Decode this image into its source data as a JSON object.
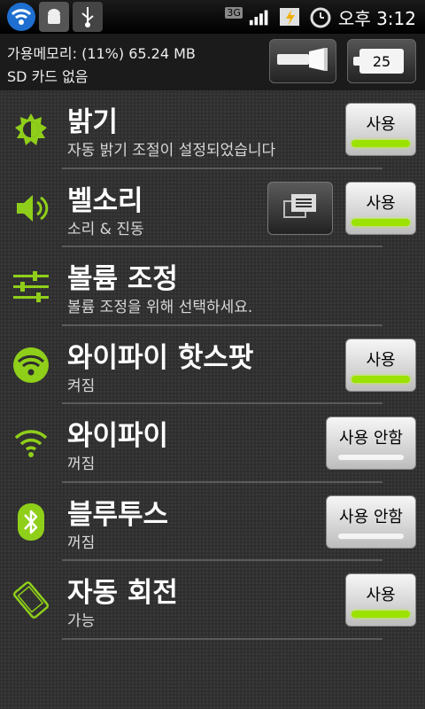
{
  "status_bar": {
    "network_tag": "3G",
    "time": "오후 3:12",
    "icons": [
      "wifi-hotspot-icon",
      "android-debug-icon",
      "usb-icon",
      "signal-icon",
      "battery-charging-icon",
      "alarm-icon"
    ]
  },
  "header": {
    "memory_line": "가용메모리: (11%) 65.24 MB",
    "sd_line": "SD 카드 없음",
    "flashlight_icon": "flashlight-icon",
    "battery_level": "25"
  },
  "settings": [
    {
      "title": "밝기",
      "subtitle": "자동 밝기 조절이 설정되었습니다",
      "toggle_label": "사용",
      "state": "on",
      "icon": "brightness-icon"
    },
    {
      "title": "벨소리",
      "subtitle": "소리 & 진동",
      "toggle_label": "사용",
      "state": "on",
      "icon": "speaker-icon"
    },
    {
      "title": "볼륨 조정",
      "subtitle": "볼륨 조정을 위해 선택하세요.",
      "icon": "volume-sliders-icon"
    },
    {
      "title": "와이파이 핫스팟",
      "subtitle": "켜짐",
      "toggle_label": "사용",
      "state": "on",
      "icon": "wifi-hotspot-icon"
    },
    {
      "title": "와이파이",
      "subtitle": "꺼짐",
      "toggle_label": "사용 안함",
      "state": "off",
      "icon": "wifi-icon"
    },
    {
      "title": "블루투스",
      "subtitle": "꺼짐",
      "toggle_label": "사용 안함",
      "state": "off",
      "icon": "bluetooth-icon"
    },
    {
      "title": "자동 회전",
      "subtitle": "가능",
      "toggle_label": "사용",
      "state": "on",
      "icon": "rotate-phone-icon"
    }
  ],
  "colors": {
    "accent": "#9be200",
    "background": "#2e2e2e",
    "icon_green": "#8fcf1a"
  }
}
